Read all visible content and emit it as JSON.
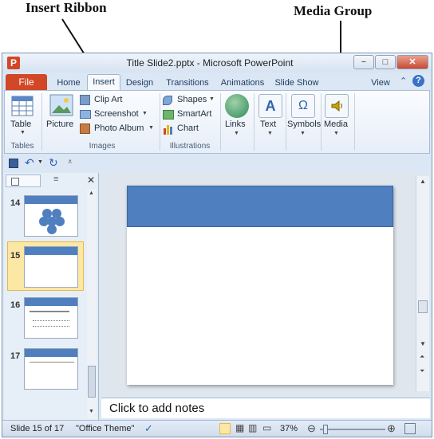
{
  "annotations": {
    "insert_ribbon": "Insert Ribbon",
    "media_group": "Media Group"
  },
  "window": {
    "title": "Title Slide2.pptx - Microsoft PowerPoint",
    "logo_letter": "P",
    "minimize": "−",
    "maximize": "□",
    "close": "✕"
  },
  "tabs": {
    "file": "File",
    "items": [
      "Home",
      "Insert",
      "Design",
      "Transitions",
      "Animations",
      "Slide Show",
      "View"
    ],
    "active": "Insert"
  },
  "ribbon": {
    "tables": {
      "table_label": "Table",
      "group_label": "Tables"
    },
    "images": {
      "picture_label": "Picture",
      "clip_art": "Clip Art",
      "screenshot": "Screenshot",
      "photo_album": "Photo Album",
      "group_label": "Images"
    },
    "illustrations": {
      "shapes": "Shapes",
      "smartart": "SmartArt",
      "chart": "Chart",
      "group_label": "Illustrations"
    },
    "links": "Links",
    "text": "Text",
    "symbols": "Symbols",
    "media": "Media",
    "symbols_glyph": "Ω"
  },
  "slides_panel": {
    "slides": [
      {
        "number": "14"
      },
      {
        "number": "15",
        "selected": true
      },
      {
        "number": "16"
      },
      {
        "number": "17"
      }
    ]
  },
  "notes": {
    "placeholder": "Click to add notes"
  },
  "status_bar": {
    "slide_info": "Slide 15 of 17",
    "theme": "\"Office Theme\"",
    "zoom": "37%"
  },
  "colors": {
    "accent": "#d24726",
    "slide_band": "#4f7fbf",
    "ribbon_bg": "#e6eef8"
  }
}
